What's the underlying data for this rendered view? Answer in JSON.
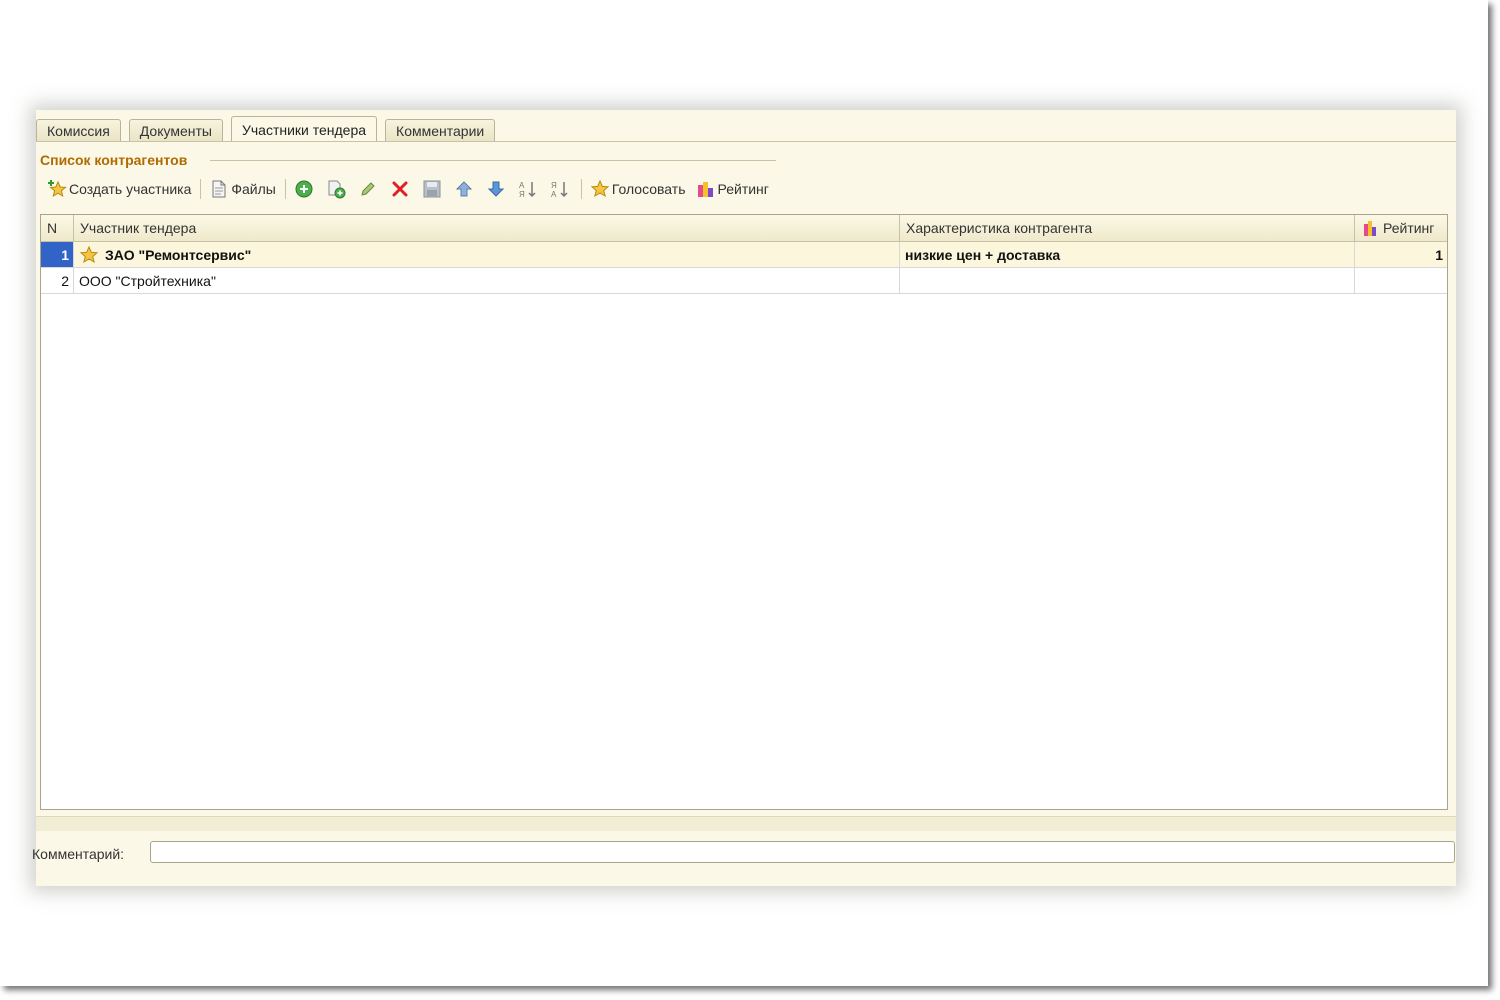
{
  "tabs": [
    {
      "label": "Комиссия",
      "active": false
    },
    {
      "label": "Документы",
      "active": false
    },
    {
      "label": "Участники тендера",
      "active": true
    },
    {
      "label": "Комментарии",
      "active": false
    }
  ],
  "group_title": "Список контрагентов",
  "toolbar": {
    "create_label": "Создать участника",
    "files_label": "Файлы",
    "vote_label": "Голосовать",
    "rating_label": "Рейтинг",
    "icons": [
      "star-add-icon",
      "document-icon",
      "add-icon",
      "copy-icon",
      "edit-icon",
      "delete-icon",
      "save-icon",
      "arrow-up-icon",
      "arrow-down-icon",
      "sort-ascending-icon",
      "sort-descending-icon",
      "star-icon",
      "rating-icon"
    ]
  },
  "table": {
    "columns": [
      "N",
      "Участник тендера",
      "Характеристика контрагента",
      "Рейтинг"
    ],
    "rows": [
      {
        "n": "1",
        "name": "ЗАО \"Ремонтсервис\"",
        "characteristic": "низкие цен + доставка",
        "rating": "1",
        "starred": true,
        "selected": true
      },
      {
        "n": "2",
        "name": "ООО \"Стройтехника\"",
        "characteristic": "",
        "rating": "",
        "starred": false,
        "selected": false
      }
    ]
  },
  "comment": {
    "label": "Комментарий:",
    "value": ""
  },
  "colors": {
    "background": "#fbf8e8",
    "group_title": "#b06a00",
    "selection": "#3264c8"
  }
}
